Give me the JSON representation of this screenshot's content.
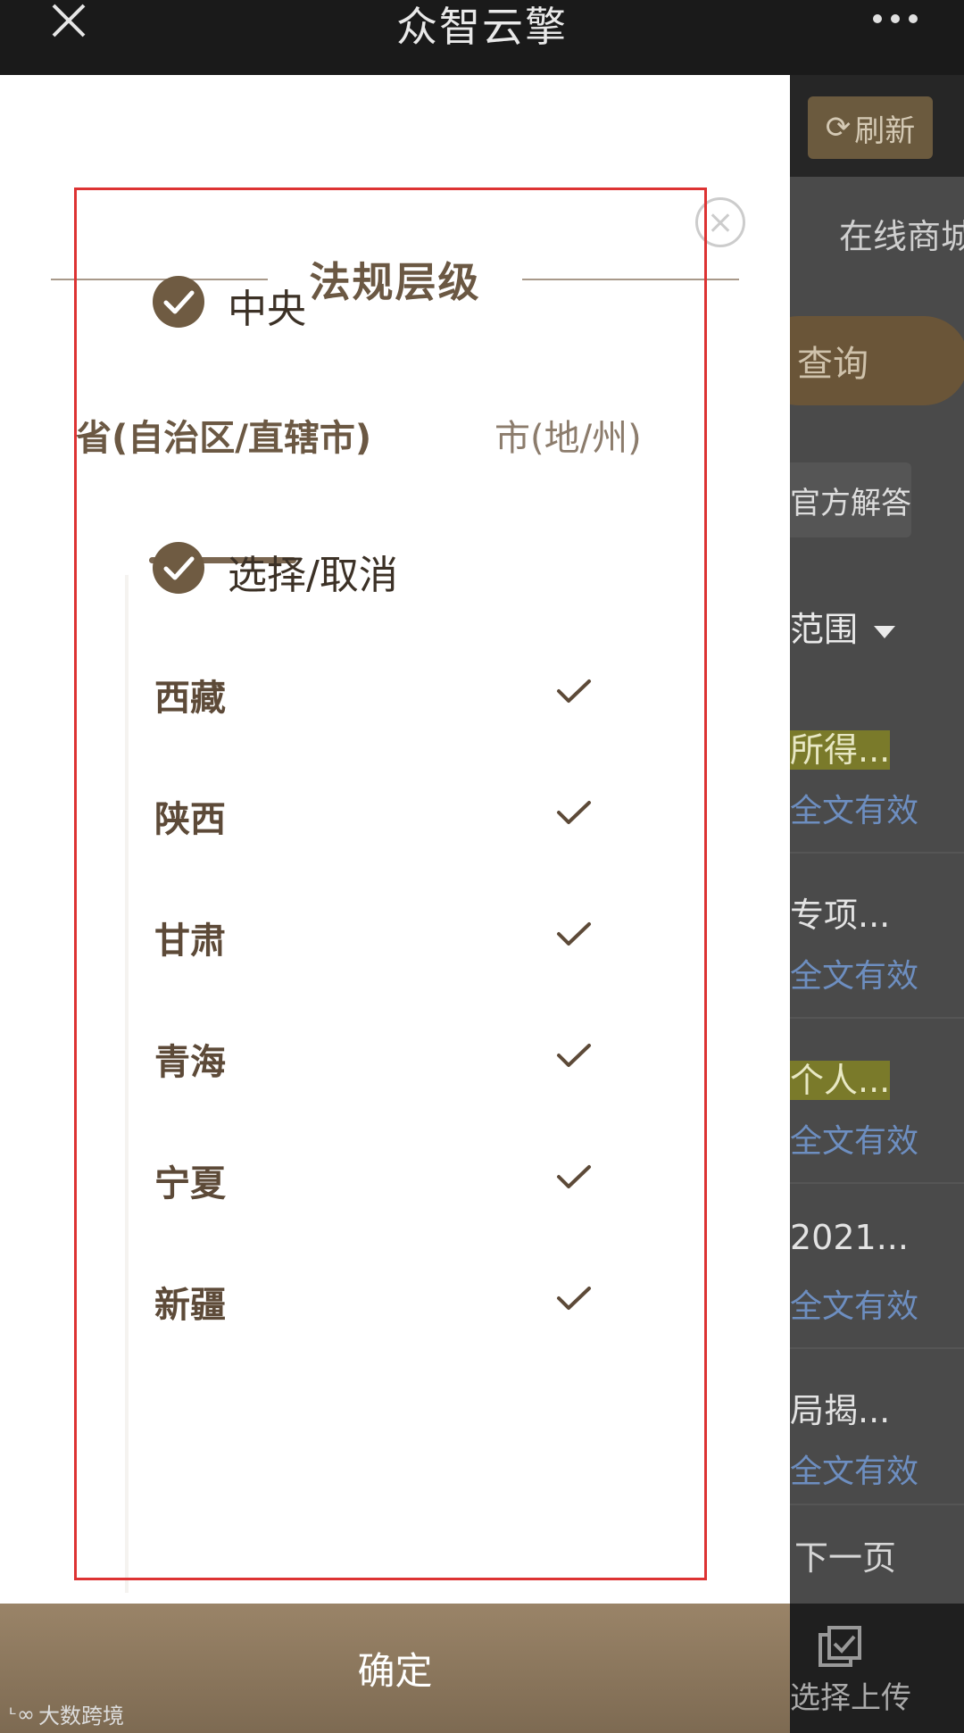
{
  "topbar": {
    "title": "众智云擎"
  },
  "background": {
    "refresh_label": "刷新",
    "mall_text": "在线商城",
    "query_label": "查询",
    "answer_label": "官方解答",
    "scope_label": "范围",
    "results": [
      {
        "title": "所得...",
        "validity": "全文有效"
      },
      {
        "title": "专项...",
        "validity": "全文有效"
      },
      {
        "title": "个人...",
        "validity": "全文有效"
      },
      {
        "title": "2021...",
        "validity": "全文有效"
      },
      {
        "title": "局揭...",
        "validity": "全文有效"
      }
    ],
    "next_page": "下一页",
    "upload_label": "选择上传"
  },
  "panel": {
    "title": "法规层级",
    "central_label": "中央",
    "tabs": [
      {
        "label": "省(自治区/直辖市)",
        "active": true
      },
      {
        "label": "市(地/州)",
        "active": false
      }
    ],
    "select_all_label": "选择/取消",
    "provinces": [
      {
        "name": "西藏",
        "checked": true
      },
      {
        "name": "陕西",
        "checked": true
      },
      {
        "name": "甘肃",
        "checked": true
      },
      {
        "name": "青海",
        "checked": true
      },
      {
        "name": "宁夏",
        "checked": true
      },
      {
        "name": "新疆",
        "checked": true
      }
    ],
    "confirm_label": "确定"
  },
  "watermark": "大数跨境",
  "colors": {
    "accent": "#6f5b42",
    "frame": "#d33333"
  }
}
